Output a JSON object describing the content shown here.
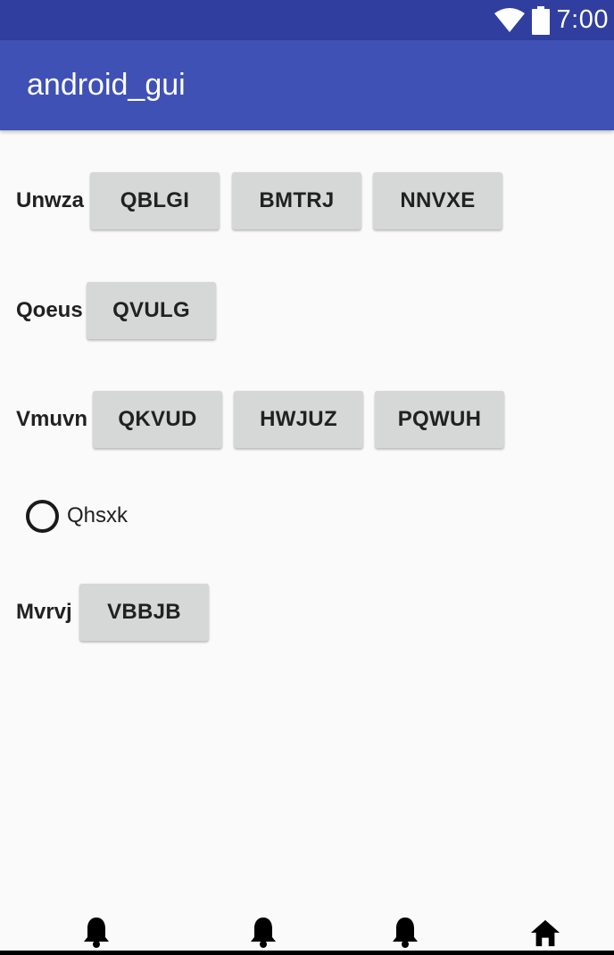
{
  "status_bar": {
    "time": "7:00",
    "icons": [
      "wifi-icon",
      "battery-icon"
    ],
    "background": "#303f9f"
  },
  "app_bar": {
    "title": "android_gui",
    "background": "#3f51b5"
  },
  "rows": [
    {
      "label": "Unwza",
      "buttons": [
        "QBLGI",
        "BMTRJ",
        "NNVXE"
      ]
    },
    {
      "label": "Qoeus",
      "buttons": [
        "QVULG"
      ]
    },
    {
      "label": "Vmuvn",
      "buttons": [
        "QKVUD",
        "HWJUZ",
        "PQWUH"
      ]
    },
    {
      "label": "Mvrvj",
      "buttons": [
        "VBBJB"
      ]
    }
  ],
  "radio": {
    "label": "Qhsxk",
    "checked": false
  },
  "bottom_nav": {
    "icons": [
      "bell-icon",
      "bell-icon",
      "bell-icon",
      "home-icon"
    ]
  },
  "colors": {
    "button_bg": "#d6d7d7",
    "page_bg": "#fafafa",
    "text": "#212121"
  }
}
